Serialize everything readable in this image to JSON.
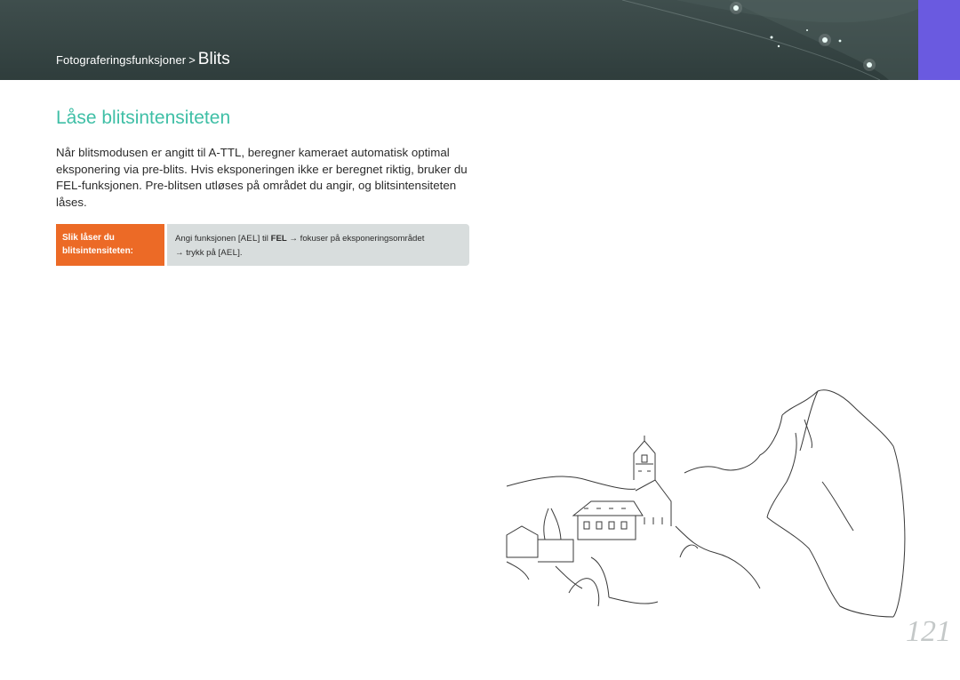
{
  "header": {
    "breadcrumb_parent": "Fotograferingsfunksjoner",
    "breadcrumb_separator": ">",
    "breadcrumb_current": "Blits",
    "side_tab_color": "#6a5ae0"
  },
  "section": {
    "title": "Låse blitsintensiteten",
    "paragraph": "Når blitsmodusen er angitt til A-TTL, beregner kameraet automatisk optimal eksponering via pre-blits. Hvis eksponeringen ikke er beregnet riktig, bruker du FEL-funksjonen. Pre-blitsen utløses på området du angir, og blitsintensiteten låses."
  },
  "procedure": {
    "label_line1": "Slik låser du",
    "label_line2": "blitsintensiteten:",
    "step1_prefix": "Angi funksjonen [",
    "step1_key": "AEL",
    "step1_mid": "] til ",
    "step1_bold": "FEL",
    "step1_arrow": "→",
    "step1_suffix": " fokuser på eksponeringsområdet",
    "step2_arrow": "→",
    "step2_prefix": " trykk på [",
    "step2_key": "AEL",
    "step2_suffix": "]."
  },
  "colors": {
    "title": "#3fbfa6",
    "label_bg": "#ec6a26",
    "content_bg": "#d8dddd",
    "header_bg": "#3f4e4d"
  },
  "page_number": "121"
}
